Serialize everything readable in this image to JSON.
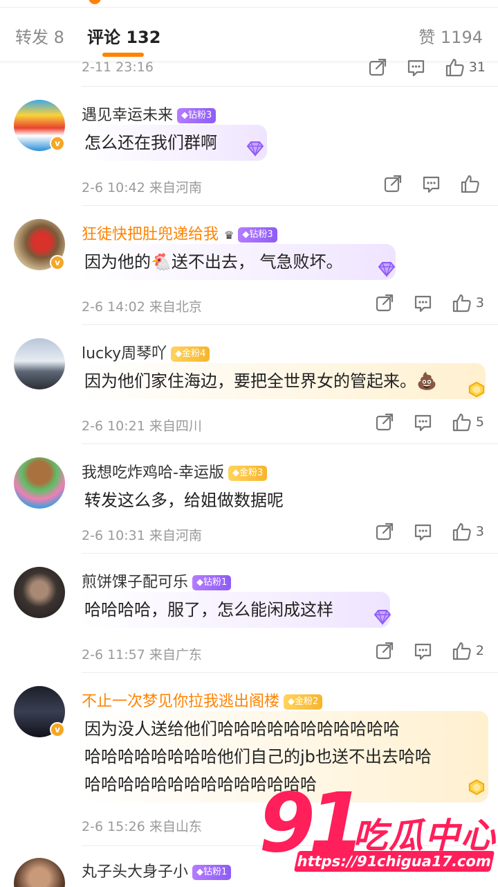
{
  "tabs": {
    "repost": "转发 8",
    "comment": "评论 132",
    "like": "赞 1194"
  },
  "prev_comment": {
    "time": "2-11 23:16",
    "likes": "31"
  },
  "comments": [
    {
      "username": "遇见幸运未来",
      "badge": "钻粉3",
      "text": "怎么还在我们群啊",
      "time": "2-6 10:42",
      "location": "来自河南",
      "likes": ""
    },
    {
      "username": "狂徒快把肚兜递给我",
      "badge": "钻粉3",
      "text": "因为他的🐔送不出去， 气急败坏。",
      "time": "2-6 14:02",
      "location": "来自北京",
      "likes": "3"
    },
    {
      "username": "lucky周琴吖",
      "badge": "金粉4",
      "text": "因为他们家住海边，要把全世界女的管起来。💩",
      "time": "2-6 10:21",
      "location": "来自四川",
      "likes": "5"
    },
    {
      "username": "我想吃炸鸡哈-幸运版",
      "badge": "金粉3",
      "text": "转发这么多，给姐做数据呢",
      "time": "2-6 10:31",
      "location": "来自河南",
      "likes": "3"
    },
    {
      "username": "煎饼馃子配可乐",
      "badge": "钻粉1",
      "text": "哈哈哈哈，服了，怎么能闲成这样",
      "time": "2-6 11:57",
      "location": "来自广东",
      "likes": "2"
    },
    {
      "username": "不止一次梦见你拉我逃出阁楼",
      "badge": "金粉2",
      "text_lines": [
        "因为没人送给他们哈哈哈哈哈哈哈哈哈哈哈",
        "哈哈哈哈哈哈哈哈他们自己的jb也送不出去哈哈",
        "哈哈哈哈哈哈哈哈哈哈哈哈哈哈"
      ],
      "time": "2-6 15:26",
      "location": "来自山东",
      "likes": ""
    },
    {
      "username": "丸子头大身子小",
      "badge": "钻粉1"
    }
  ],
  "watermark": {
    "number": "91",
    "name": "吃瓜中心",
    "url": "https://91chigua17.com"
  },
  "icons": [
    "share-icon",
    "comment-icon",
    "like-icon",
    "verified-icon",
    "gem-icon"
  ],
  "colors": {
    "accent": "#ff8200",
    "diamond_badge": "#9b6cff",
    "gold_badge": "#f7b52c",
    "watermark": "#ff1f5a"
  }
}
